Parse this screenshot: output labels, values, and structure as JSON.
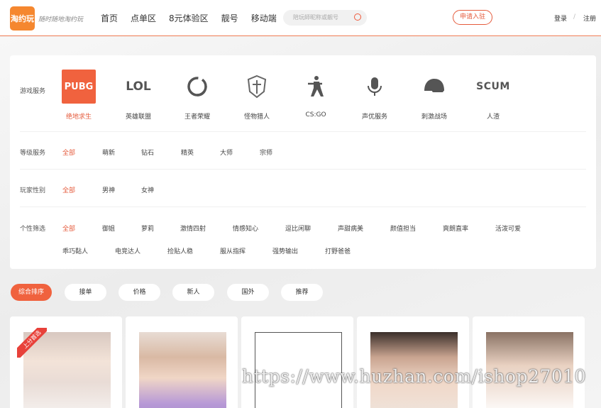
{
  "header": {
    "logo_text": "淘约玩",
    "slogan": "随时随地淘约玩",
    "nav": [
      "首页",
      "点单区",
      "8元体验区",
      "靓号",
      "移动端"
    ],
    "search_placeholder": "陪玩師昵称或靓号",
    "apply_label": "申请入驻",
    "login_label": "登录",
    "separator": "/",
    "register_label": "注册",
    "accent_color": "#e55b3c"
  },
  "filters": {
    "game_label": "游戏服务",
    "games": [
      {
        "name": "绝地求生",
        "icon": "PUBG",
        "icon_name": "pubg-icon"
      },
      {
        "name": "英雄联盟",
        "icon": "LOL",
        "icon_name": "lol-icon"
      },
      {
        "name": "王者荣耀",
        "icon": "",
        "icon_name": "honor-of-kings-icon"
      },
      {
        "name": "怪物猎人",
        "icon": "",
        "icon_name": "monster-hunter-icon"
      },
      {
        "name": "CS:GO",
        "icon": "",
        "icon_name": "csgo-icon"
      },
      {
        "name": "声优服务",
        "icon": "",
        "icon_name": "microphone-icon"
      },
      {
        "name": "刺激战场",
        "icon": "",
        "icon_name": "helmet-icon"
      },
      {
        "name": "人渣",
        "icon": "SCUM",
        "icon_name": "scum-icon"
      }
    ],
    "level_label": "等级服务",
    "levels": [
      "全部",
      "萌新",
      "钻石",
      "精英",
      "大师",
      "宗师"
    ],
    "gender_label": "玩家性别",
    "genders": [
      "全部",
      "男神",
      "女神"
    ],
    "trait_label": "个性筛选",
    "traits_row1": [
      "全部",
      "御姐",
      "萝莉",
      "激情四射",
      "情感知心",
      "逗比闲聊",
      "声甜病美",
      "颜值担当",
      "爽朗直率",
      "活泼可爱"
    ],
    "traits_row2": [
      "乖巧黏人",
      "电竞达人",
      "捡贴人稳",
      "服从指挥",
      "强势输出",
      "打野爸爸"
    ]
  },
  "sort": [
    "综合排序",
    "接单",
    "价格",
    "新人",
    "国外",
    "推荐"
  ],
  "cards": [
    {
      "badge": "上分首选"
    },
    {
      "badge": ""
    },
    {
      "badge": ""
    },
    {
      "badge": ""
    },
    {
      "badge": ""
    }
  ],
  "watermark": "https://www.huzhan.com/ishop27010"
}
